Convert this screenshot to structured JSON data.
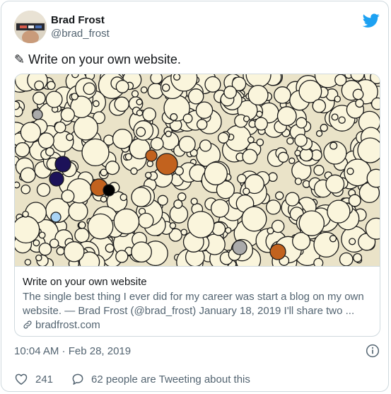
{
  "author": {
    "name": "Brad Frost",
    "handle": "@brad_frost",
    "avatar_icon": "avatar-photo"
  },
  "tweet": {
    "pencil_glyph": "✎",
    "text": "Write on your own website."
  },
  "link_card": {
    "title": "Write on your own website",
    "description": "The single best thing I ever did for my career was start a blog on my own website. — Brad Frost (@brad_frost) January 18, 2019 I'll share two ...",
    "domain": "bradfrost.com",
    "image_icon": "bubbles-illustration"
  },
  "meta": {
    "timestamp": "10:04 AM · Feb 28, 2019"
  },
  "actions": {
    "likes": "241",
    "replies": "62 people are Tweeting about this"
  },
  "colors": {
    "brand": "#1da1f2",
    "text": "#14171a",
    "muted": "#536471",
    "border": "#cfd9de",
    "bubble_fill": "#faf5dc",
    "bubble_stroke": "#1a1a1a",
    "accent_orange": "#c2621e",
    "accent_navy": "#1c1259",
    "accent_gray": "#aaaaaa"
  }
}
